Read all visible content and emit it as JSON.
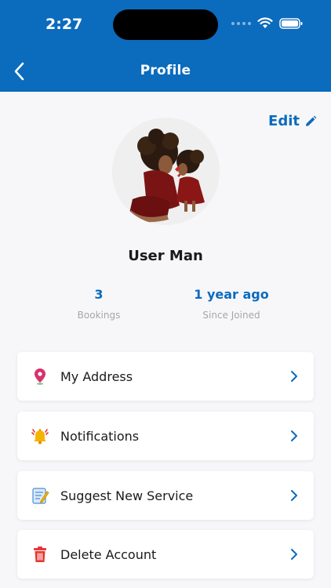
{
  "status_bar": {
    "time": "2:27"
  },
  "nav": {
    "title": "Profile"
  },
  "profile": {
    "edit_label": "Edit",
    "name": "User Man",
    "stats": [
      {
        "value": "3",
        "label": "Bookings"
      },
      {
        "value": "1 year ago",
        "label": "Since Joined"
      }
    ]
  },
  "menu": [
    {
      "label": "My Address",
      "icon": "location-pin-icon"
    },
    {
      "label": "Notifications",
      "icon": "bell-icon"
    },
    {
      "label": "Suggest New Service",
      "icon": "notepad-icon"
    },
    {
      "label": "Delete Account",
      "icon": "trash-icon"
    }
  ],
  "colors": {
    "primary": "#0b6bbd",
    "pin": "#d6336c",
    "bell": "#f5b400",
    "trash": "#e53935"
  }
}
